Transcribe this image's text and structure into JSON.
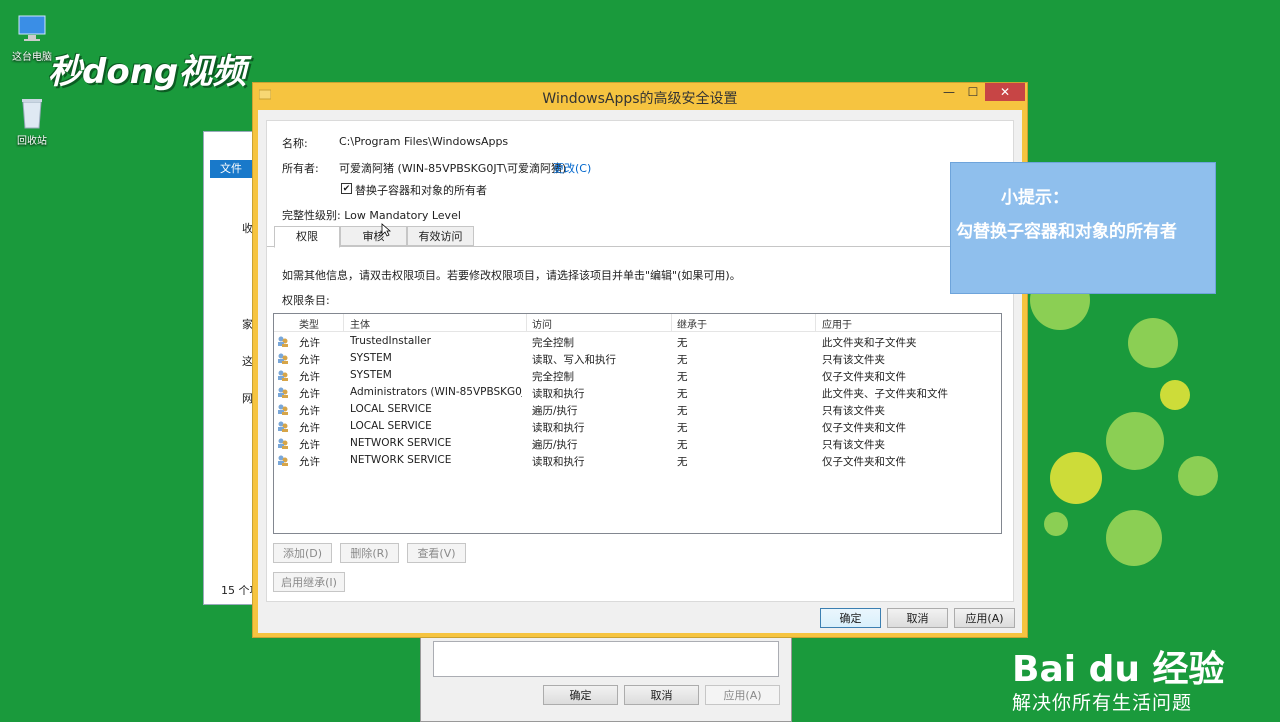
{
  "desktop": {
    "icons": [
      {
        "label": "这台电脑",
        "icon": "computer-icon"
      },
      {
        "label": "回收站",
        "icon": "recycle-bin-icon"
      }
    ],
    "watermark_logo": "秒dong视频"
  },
  "explorer_bg": {
    "file_tab": "文件",
    "nav_items": [
      "收",
      "家",
      "这",
      "网"
    ],
    "status": "15 个项"
  },
  "bg_dialog": {
    "ok": "确定",
    "cancel": "取消",
    "apply": "应用(A)"
  },
  "window": {
    "title": "WindowsApps的高级安全设置",
    "controls": {
      "minimize": "—",
      "maximize": "☐",
      "close": "✕"
    },
    "name_label": "名称:",
    "name_value": "C:\\Program Files\\WindowsApps",
    "owner_label": "所有者:",
    "owner_value": "可爱滴阿猪 (WIN-85VPBSKG0JT\\可爱滴阿猪)",
    "owner_change": "更改(C)",
    "replace_owner_checkbox": "替换子容器和对象的所有者",
    "replace_owner_checked": true,
    "integrity_label": "完整性级别: Low Mandatory Level",
    "tabs": [
      "权限",
      "审核",
      "有效访问"
    ],
    "active_tab": "权限",
    "info_text": "如需其他信息，请双击权限项目。若要修改权限项目，请选择该项目并单击\"编辑\"(如果可用)。",
    "entries_label": "权限条目:",
    "columns": [
      "类型",
      "主体",
      "访问",
      "继承于",
      "应用于"
    ],
    "rows": [
      [
        "允许",
        "TrustedInstaller",
        "完全控制",
        "无",
        "此文件夹和子文件夹"
      ],
      [
        "允许",
        "SYSTEM",
        "读取、写入和执行",
        "无",
        "只有该文件夹"
      ],
      [
        "允许",
        "SYSTEM",
        "完全控制",
        "无",
        "仅子文件夹和文件"
      ],
      [
        "允许",
        "Administrators (WIN-85VPBSKG0J...",
        "读取和执行",
        "无",
        "此文件夹、子文件夹和文件"
      ],
      [
        "允许",
        "LOCAL SERVICE",
        "遍历/执行",
        "无",
        "只有该文件夹"
      ],
      [
        "允许",
        "LOCAL SERVICE",
        "读取和执行",
        "无",
        "仅子文件夹和文件"
      ],
      [
        "允许",
        "NETWORK SERVICE",
        "遍历/执行",
        "无",
        "只有该文件夹"
      ],
      [
        "允许",
        "NETWORK SERVICE",
        "读取和执行",
        "无",
        "仅子文件夹和文件"
      ]
    ],
    "add": "添加(D)",
    "remove": "删除(R)",
    "view": "查看(V)",
    "enable_inherit": "启用继承(I)",
    "ok": "确定",
    "cancel": "取消",
    "apply": "应用(A)"
  },
  "hint": {
    "title": "小提示：",
    "body": "勾替换子容器和对象的所有者"
  },
  "baidu": {
    "logo": "Bai du 经验",
    "slogan": "解决你所有生活问题"
  },
  "colors": {
    "desktop_green": "#1a9a3c",
    "window_frame": "#f6c440",
    "close_red": "#c74545",
    "hint_blue": "#8fbfed",
    "link": "#0066cc"
  }
}
